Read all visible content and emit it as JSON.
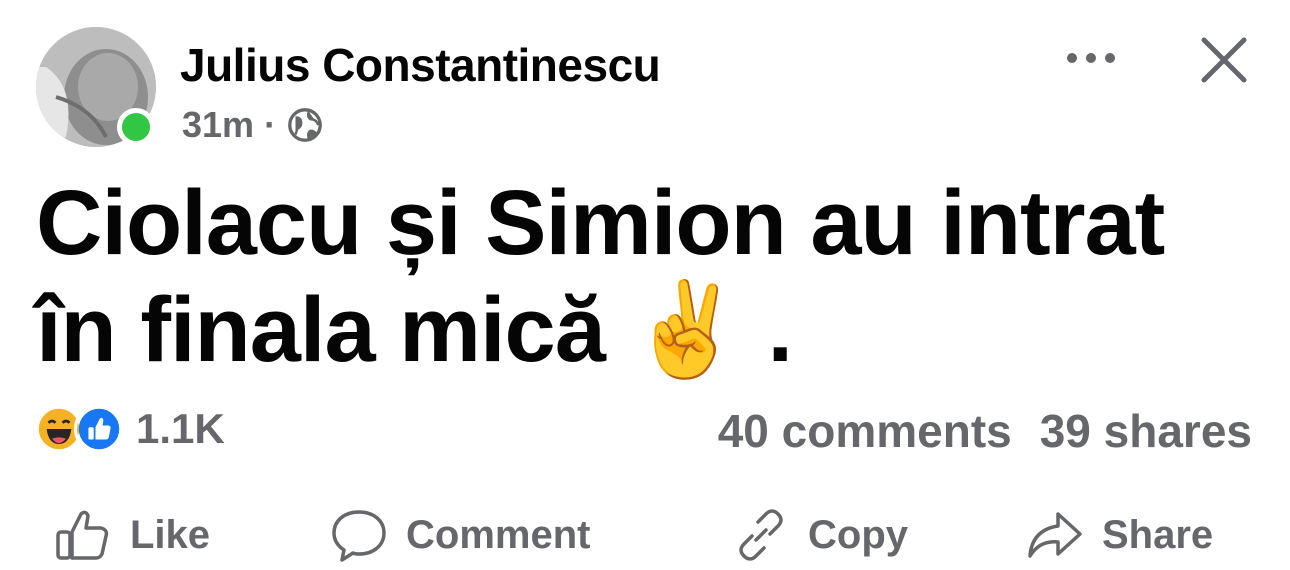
{
  "post": {
    "author": "Julius Constantinescu",
    "time": "31m",
    "separator": "·",
    "privacy_icon": "globe-icon",
    "text_line1": "Ciolacu și Simion au intrat",
    "text_line2": "în finala mică ✌️ ."
  },
  "engagement": {
    "reactions": [
      "haha-reaction",
      "like-reaction"
    ],
    "reaction_count": "1.1K",
    "comments": "40 comments",
    "shares": "39 shares"
  },
  "actions": {
    "like": "Like",
    "comment": "Comment",
    "copy": "Copy",
    "share": "Share"
  },
  "colors": {
    "online": "#31c744",
    "like_blue": "#1877f2",
    "muted": "#65676b",
    "haha_yellow": "#f7b125"
  }
}
